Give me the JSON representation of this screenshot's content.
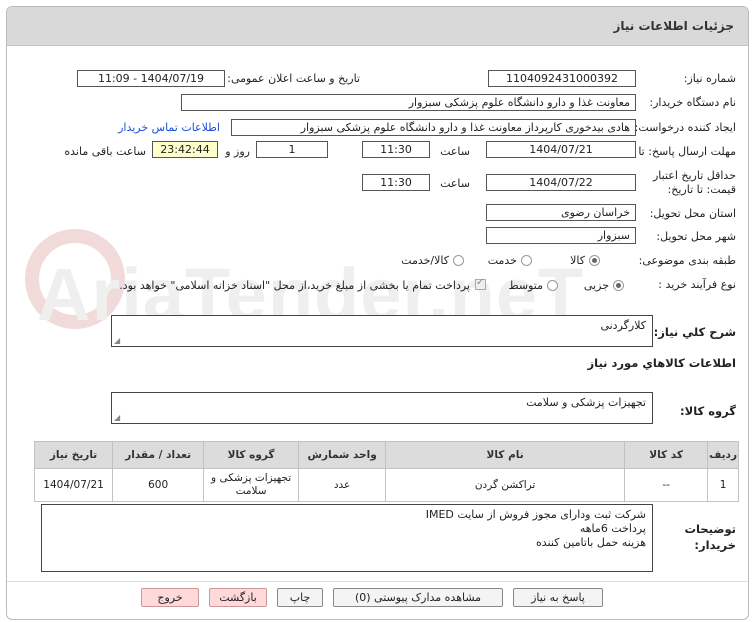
{
  "header": {
    "title": "جزئیات اطلاعات نیاز"
  },
  "form": {
    "need_number_label": "شماره نیاز:",
    "need_number": "1104092431000392",
    "announce_label": "تاریخ و ساعت اعلان عمومی:",
    "announce_value": "1404/07/19 - 11:09",
    "buyer_org_label": "نام دستگاه خریدار:",
    "buyer_org": "معاونت غذا و دارو   دانشگاه علوم پزشکی سبزوار",
    "requester_label": "ایجاد کننده درخواست:",
    "requester": "هادی بیدخوری کارپرداز معاونت غذا و دارو   دانشگاه علوم پزشکی سبزوار",
    "contact_link": "اطلاعات تماس خریدار",
    "reply_deadline_label": "مهلت ارسال پاسخ: تا تاریخ:",
    "reply_date": "1404/07/21",
    "time_label": "ساعت",
    "reply_time": "11:30",
    "days_count": "1",
    "days_label": "روز و",
    "remaining_time": "23:42:44",
    "remaining_label": "ساعت باقی مانده",
    "validity_label": "حداقل تاریخ اعتبار قیمت: تا تاریخ:",
    "validity_date": "1404/07/22",
    "validity_time": "11:30",
    "province_label": "استان محل تحویل:",
    "province": "خراسان رضوی",
    "city_label": "شهر محل تحویل:",
    "city": "سبزوار",
    "category_label": "طبقه بندی موضوعی:",
    "category_options": [
      "کالا",
      "خدمت",
      "کالا/خدمت"
    ],
    "process_label": "نوع فرآیند خرید :",
    "process_options": [
      "جزیی",
      "متوسط"
    ],
    "payment_note": "پرداخت تمام یا بخشی از مبلغ خرید،از محل \"اسناد خزانه اسلامی\" خواهد بود."
  },
  "summary": {
    "label": "شرح كلي نياز:",
    "value": "کلارگردنی"
  },
  "goods": {
    "section_title": "اطلاعات کالاهاي مورد نياز",
    "group_label": "گروه کالا:",
    "group_value": "تجهیزات پزشکی و سلامت"
  },
  "table": {
    "headers": [
      "ردیف",
      "کد کالا",
      "نام کالا",
      "واحد شمارش",
      "گروه کالا",
      "تعداد / مقدار",
      "تاریخ نیاز"
    ],
    "rows": [
      [
        "1",
        "--",
        "تراکشن گردن",
        "عدد",
        "تجهیزات پزشکی و سلامت",
        "600",
        "1404/07/21"
      ]
    ]
  },
  "notes": {
    "label": "توضیحات خریدار:",
    "lines": [
      "شرکت ثبت ودارای مجوز فروش از سایت IMED",
      "پرداخت 6ماهه",
      "هزینه حمل باتامین کننده"
    ]
  },
  "buttons": {
    "reply": "پاسخ به نیاز",
    "attachments": "مشاهده مدارک پیوستی (0)",
    "print": "چاپ",
    "back": "بازگشت",
    "exit": "خروج"
  },
  "watermark": "AriaTender.neT"
}
